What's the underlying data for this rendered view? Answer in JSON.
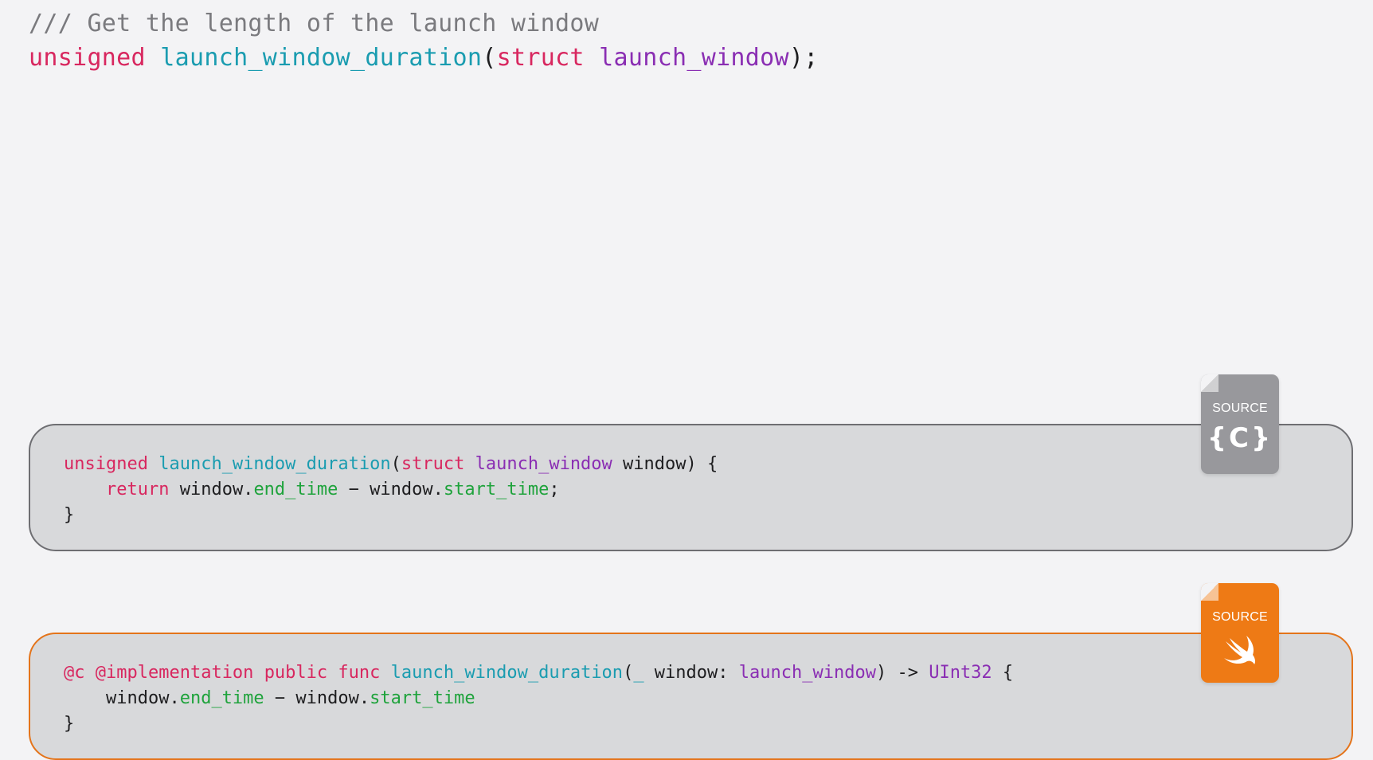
{
  "header": {
    "comment": "/// Get the length of the launch window",
    "decl": {
      "kw1": "unsigned",
      "space1": " ",
      "fn": "launch_window_duration",
      "open": "(",
      "kw2": "struct",
      "space2": " ",
      "ty": "launch_window",
      "close": ");"
    }
  },
  "c_block": {
    "badge_label": "SOURCE",
    "badge_glyph": "{C}",
    "badge_icon": "c-language-icon",
    "border_color": "#6e6e72",
    "line1": {
      "kw1": "unsigned",
      "sp1": " ",
      "fn": "launch_window_duration",
      "open": "(",
      "kw2": "struct",
      "sp2": " ",
      "ty": "launch_window",
      "rest": " window) {"
    },
    "line2": {
      "indent": "    ",
      "kw": "return",
      "p1": " window.",
      "prop1": "end_time",
      "p2": " − window.",
      "prop2": "start_time",
      "p3": ";"
    },
    "line3": "}"
  },
  "swift_block": {
    "badge_label": "SOURCE",
    "badge_icon": "swift-logo-icon",
    "border_color": "#e4741a",
    "line1": {
      "kw1": "@c",
      "sp1": " ",
      "kw2": "@implementation",
      "sp2": " ",
      "kw3": "public",
      "sp3": " ",
      "kw4": "func",
      "sp4": " ",
      "fn": "launch_window_duration",
      "open": "(",
      "underscore": "_",
      "p1": " window: ",
      "ty1": "launch_window",
      "p2": ") -> ",
      "ty2": "UInt32",
      "p3": " {"
    },
    "line2": {
      "indent": "    ",
      "p1": "window.",
      "prop1": "end_time",
      "p2": " − window.",
      "prop2": "start_time"
    },
    "line3": "}"
  },
  "colors": {
    "background": "#f3f3f5",
    "keyword": "#d8275f",
    "function": "#1a9cb0",
    "type": "#8a2eb3",
    "property": "#1fa33c",
    "comment": "#7a7a7e",
    "c_badge": "#98989c",
    "swift_badge": "#ee7a15"
  }
}
